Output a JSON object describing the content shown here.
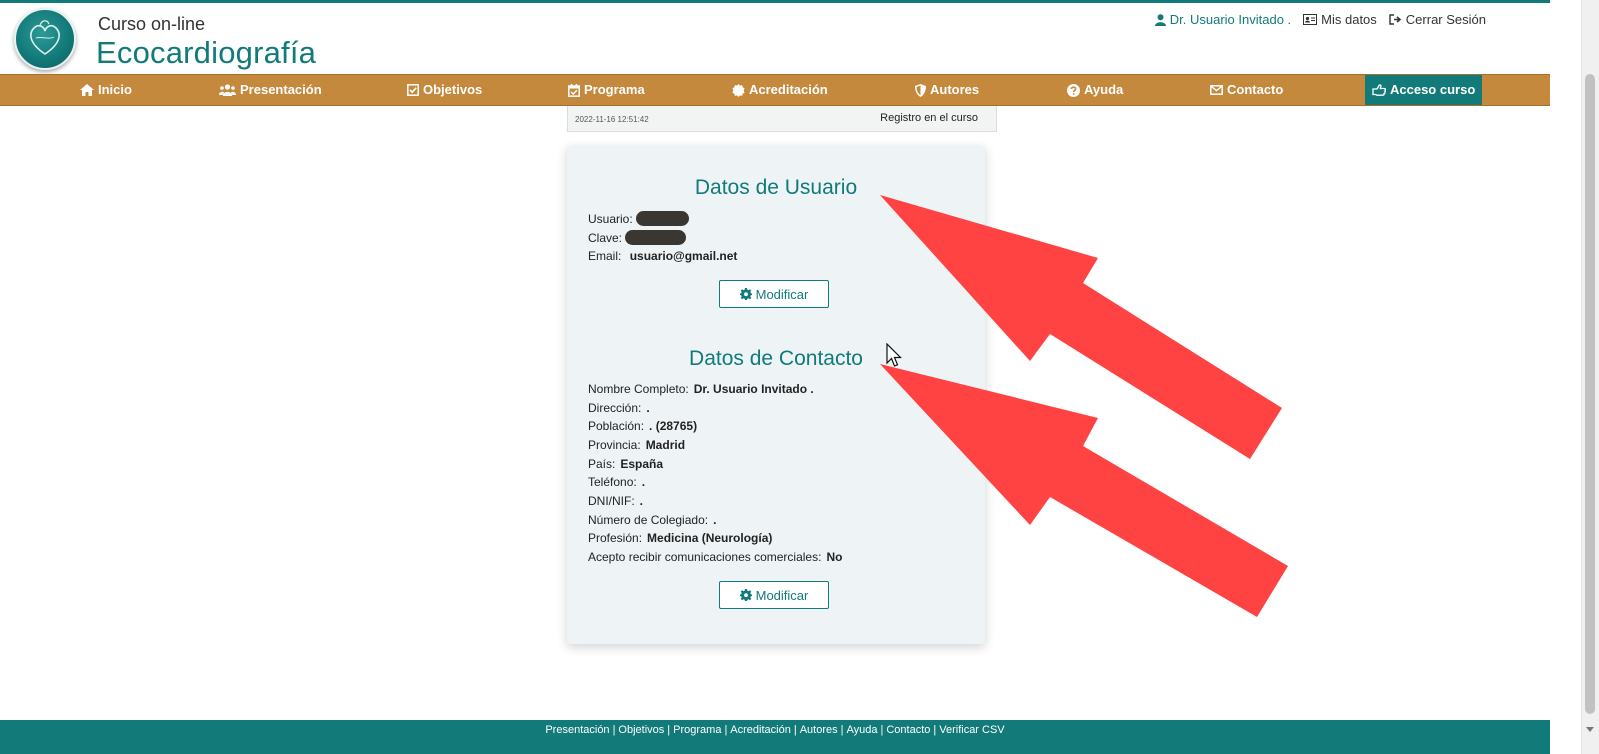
{
  "brand": {
    "top": "Curso  on-line",
    "main": "Ecocardiografía"
  },
  "userbar": {
    "user": "Dr. Usuario Invitado .",
    "mis_datos": "Mis datos",
    "logout": "Cerrar Sesión"
  },
  "nav": [
    {
      "label": "Inicio",
      "icon": "home-icon"
    },
    {
      "label": "Presentación",
      "icon": "users-icon"
    },
    {
      "label": "Objetivos",
      "icon": "checkbox-icon"
    },
    {
      "label": "Programa",
      "icon": "calendar-check-icon"
    },
    {
      "label": "Acreditación",
      "icon": "certificate-icon"
    },
    {
      "label": "Autores",
      "icon": "shield-icon"
    },
    {
      "label": "Ayuda",
      "icon": "question-icon"
    },
    {
      "label": "Contacto",
      "icon": "envelope-icon"
    },
    {
      "label": "Acceso curso",
      "icon": "hand-pointer-icon",
      "active": true
    }
  ],
  "registro": {
    "date": "2022-11-16 12:51:42",
    "label": "Registro en el curso"
  },
  "usuario": {
    "title": "Datos de Usuario",
    "usuario_label": "Usuario:",
    "clave_label": "Clave:",
    "email_label": "Email:",
    "email_value": "usuario@gmail.net",
    "button": "Modificar"
  },
  "contacto": {
    "title": "Datos de Contacto",
    "fields": [
      {
        "label": "Nombre Completo:",
        "value": "Dr. Usuario Invitado ."
      },
      {
        "label": "Dirección:",
        "value": "."
      },
      {
        "label": "Población:",
        "value": ". (28765)"
      },
      {
        "label": "Provincia:",
        "value": "Madrid"
      },
      {
        "label": "País:",
        "value": "España"
      },
      {
        "label": "Teléfono:",
        "value": "."
      },
      {
        "label": "DNI/NIF:",
        "value": "."
      },
      {
        "label": "Número de Colegiado:",
        "value": "."
      },
      {
        "label": "Profesión:",
        "value": "Medicina (Neurología)"
      },
      {
        "label": "Acepto recibir comunicaciones comerciales:",
        "value": "No"
      }
    ],
    "button": "Modificar"
  },
  "footer": [
    "Presentación",
    "Objetivos",
    "Programa",
    "Acreditación",
    "Autores",
    "Ayuda",
    "Contacto",
    "Verificar CSV"
  ],
  "colors": {
    "teal": "#137a7a",
    "nav": "#c5893d",
    "card": "#eef4f5",
    "arrow": "#ff4242"
  }
}
